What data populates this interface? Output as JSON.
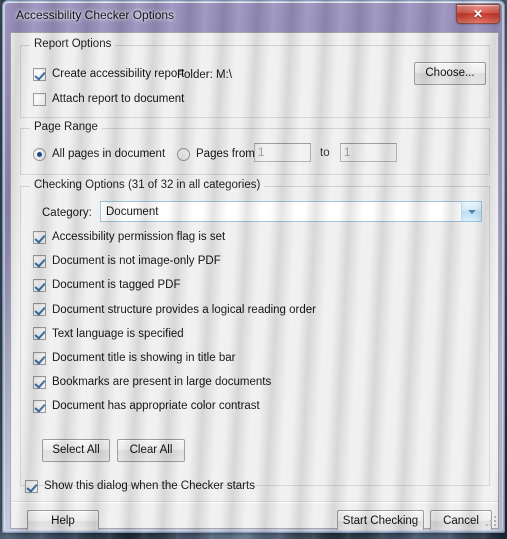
{
  "window": {
    "title": "Accessibility Checker Options",
    "close_glyph": "✕",
    "close_label": "Close"
  },
  "report_options": {
    "legend": "Report Options",
    "create_report": {
      "label": "Create accessibility report",
      "checked": true
    },
    "folder_label": "Folder: M:\\",
    "choose_button": "Choose...",
    "attach_report": {
      "label": "Attach report to document",
      "checked": false
    }
  },
  "page_range": {
    "legend": "Page Range",
    "all_pages": {
      "label": "All pages in document",
      "selected": true
    },
    "pages_from": {
      "label": "Pages from",
      "selected": false
    },
    "from_value": "1",
    "to_label": "to",
    "to_value": "1"
  },
  "checking_options": {
    "legend": "Checking Options (31 of 32 in all categories)",
    "category_label": "Category:",
    "category_value": "Document",
    "category_options": [
      "Document"
    ],
    "items": [
      {
        "label": "Accessibility permission flag is set",
        "checked": true
      },
      {
        "label": "Document is not image-only PDF",
        "checked": true
      },
      {
        "label": "Document is tagged PDF",
        "checked": true
      },
      {
        "label": "Document structure provides a logical reading order",
        "checked": true
      },
      {
        "label": "Text language is specified",
        "checked": true
      },
      {
        "label": "Document title is showing in title bar",
        "checked": true
      },
      {
        "label": "Bookmarks are present in large documents",
        "checked": true
      },
      {
        "label": "Document has appropriate color contrast",
        "checked": true
      }
    ],
    "select_all_button": "Select All",
    "clear_all_button": "Clear All"
  },
  "show_dialog": {
    "label": "Show this dialog when the Checker starts",
    "checked": true
  },
  "footer": {
    "help_button": "Help",
    "start_checking_button": "Start Checking",
    "cancel_button": "Cancel"
  },
  "colors": {
    "close_button": "#c53628",
    "accent_check": "#3a6ea5",
    "radio_dot": "#1c4f8f",
    "dialog_face": "#f0f0f0"
  }
}
